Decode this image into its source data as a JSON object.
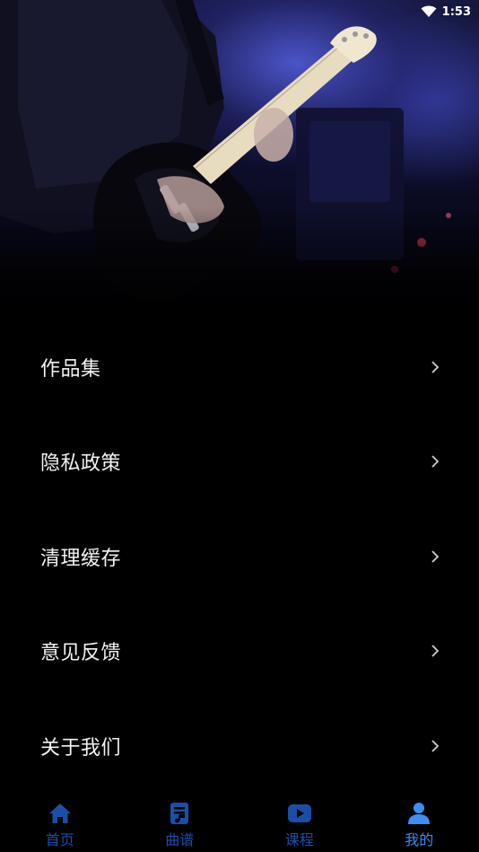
{
  "status": {
    "time": "1:53"
  },
  "hero": {
    "image": "guitarist-playing-electric-guitar-on-stage"
  },
  "menu": {
    "items": [
      {
        "label": "作品集",
        "icon": "chevron-right-icon"
      },
      {
        "label": "隐私政策",
        "icon": "chevron-right-icon"
      },
      {
        "label": "清理缓存",
        "icon": "chevron-right-icon"
      },
      {
        "label": "意见反馈",
        "icon": "chevron-right-icon"
      },
      {
        "label": "关于我们",
        "icon": "chevron-right-icon"
      }
    ]
  },
  "tabbar": {
    "active_color": "#3c8ef2",
    "inactive_color": "#1a4fa8",
    "tabs": [
      {
        "label": "首页",
        "icon": "home-icon",
        "active": false
      },
      {
        "label": "曲谱",
        "icon": "sheet-music-icon",
        "active": false
      },
      {
        "label": "课程",
        "icon": "video-play-icon",
        "active": false
      },
      {
        "label": "我的",
        "icon": "person-icon",
        "active": true
      }
    ]
  }
}
